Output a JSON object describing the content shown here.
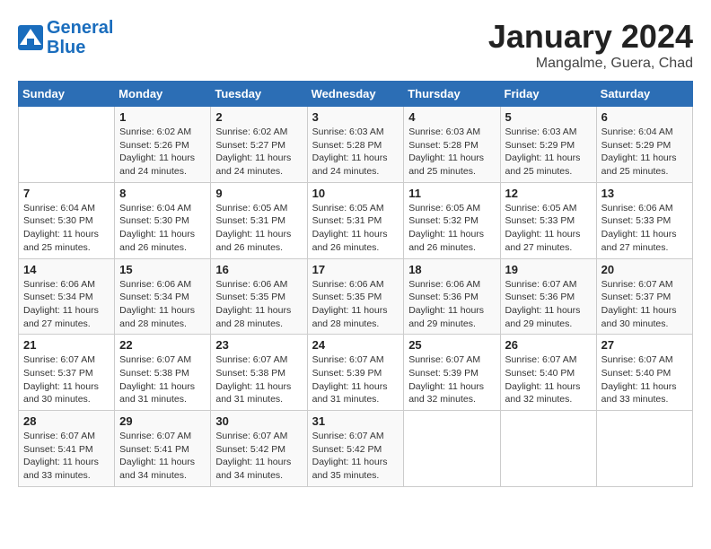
{
  "header": {
    "logo_line1": "General",
    "logo_line2": "Blue",
    "month_title": "January 2024",
    "location": "Mangalme, Guera, Chad"
  },
  "weekdays": [
    "Sunday",
    "Monday",
    "Tuesday",
    "Wednesday",
    "Thursday",
    "Friday",
    "Saturday"
  ],
  "weeks": [
    [
      {
        "day": "",
        "content": ""
      },
      {
        "day": "1",
        "content": "Sunrise: 6:02 AM\nSunset: 5:26 PM\nDaylight: 11 hours\nand 24 minutes."
      },
      {
        "day": "2",
        "content": "Sunrise: 6:02 AM\nSunset: 5:27 PM\nDaylight: 11 hours\nand 24 minutes."
      },
      {
        "day": "3",
        "content": "Sunrise: 6:03 AM\nSunset: 5:28 PM\nDaylight: 11 hours\nand 24 minutes."
      },
      {
        "day": "4",
        "content": "Sunrise: 6:03 AM\nSunset: 5:28 PM\nDaylight: 11 hours\nand 25 minutes."
      },
      {
        "day": "5",
        "content": "Sunrise: 6:03 AM\nSunset: 5:29 PM\nDaylight: 11 hours\nand 25 minutes."
      },
      {
        "day": "6",
        "content": "Sunrise: 6:04 AM\nSunset: 5:29 PM\nDaylight: 11 hours\nand 25 minutes."
      }
    ],
    [
      {
        "day": "7",
        "content": "Sunrise: 6:04 AM\nSunset: 5:30 PM\nDaylight: 11 hours\nand 25 minutes."
      },
      {
        "day": "8",
        "content": "Sunrise: 6:04 AM\nSunset: 5:30 PM\nDaylight: 11 hours\nand 26 minutes."
      },
      {
        "day": "9",
        "content": "Sunrise: 6:05 AM\nSunset: 5:31 PM\nDaylight: 11 hours\nand 26 minutes."
      },
      {
        "day": "10",
        "content": "Sunrise: 6:05 AM\nSunset: 5:31 PM\nDaylight: 11 hours\nand 26 minutes."
      },
      {
        "day": "11",
        "content": "Sunrise: 6:05 AM\nSunset: 5:32 PM\nDaylight: 11 hours\nand 26 minutes."
      },
      {
        "day": "12",
        "content": "Sunrise: 6:05 AM\nSunset: 5:33 PM\nDaylight: 11 hours\nand 27 minutes."
      },
      {
        "day": "13",
        "content": "Sunrise: 6:06 AM\nSunset: 5:33 PM\nDaylight: 11 hours\nand 27 minutes."
      }
    ],
    [
      {
        "day": "14",
        "content": "Sunrise: 6:06 AM\nSunset: 5:34 PM\nDaylight: 11 hours\nand 27 minutes."
      },
      {
        "day": "15",
        "content": "Sunrise: 6:06 AM\nSunset: 5:34 PM\nDaylight: 11 hours\nand 28 minutes."
      },
      {
        "day": "16",
        "content": "Sunrise: 6:06 AM\nSunset: 5:35 PM\nDaylight: 11 hours\nand 28 minutes."
      },
      {
        "day": "17",
        "content": "Sunrise: 6:06 AM\nSunset: 5:35 PM\nDaylight: 11 hours\nand 28 minutes."
      },
      {
        "day": "18",
        "content": "Sunrise: 6:06 AM\nSunset: 5:36 PM\nDaylight: 11 hours\nand 29 minutes."
      },
      {
        "day": "19",
        "content": "Sunrise: 6:07 AM\nSunset: 5:36 PM\nDaylight: 11 hours\nand 29 minutes."
      },
      {
        "day": "20",
        "content": "Sunrise: 6:07 AM\nSunset: 5:37 PM\nDaylight: 11 hours\nand 30 minutes."
      }
    ],
    [
      {
        "day": "21",
        "content": "Sunrise: 6:07 AM\nSunset: 5:37 PM\nDaylight: 11 hours\nand 30 minutes."
      },
      {
        "day": "22",
        "content": "Sunrise: 6:07 AM\nSunset: 5:38 PM\nDaylight: 11 hours\nand 31 minutes."
      },
      {
        "day": "23",
        "content": "Sunrise: 6:07 AM\nSunset: 5:38 PM\nDaylight: 11 hours\nand 31 minutes."
      },
      {
        "day": "24",
        "content": "Sunrise: 6:07 AM\nSunset: 5:39 PM\nDaylight: 11 hours\nand 31 minutes."
      },
      {
        "day": "25",
        "content": "Sunrise: 6:07 AM\nSunset: 5:39 PM\nDaylight: 11 hours\nand 32 minutes."
      },
      {
        "day": "26",
        "content": "Sunrise: 6:07 AM\nSunset: 5:40 PM\nDaylight: 11 hours\nand 32 minutes."
      },
      {
        "day": "27",
        "content": "Sunrise: 6:07 AM\nSunset: 5:40 PM\nDaylight: 11 hours\nand 33 minutes."
      }
    ],
    [
      {
        "day": "28",
        "content": "Sunrise: 6:07 AM\nSunset: 5:41 PM\nDaylight: 11 hours\nand 33 minutes."
      },
      {
        "day": "29",
        "content": "Sunrise: 6:07 AM\nSunset: 5:41 PM\nDaylight: 11 hours\nand 34 minutes."
      },
      {
        "day": "30",
        "content": "Sunrise: 6:07 AM\nSunset: 5:42 PM\nDaylight: 11 hours\nand 34 minutes."
      },
      {
        "day": "31",
        "content": "Sunrise: 6:07 AM\nSunset: 5:42 PM\nDaylight: 11 hours\nand 35 minutes."
      },
      {
        "day": "",
        "content": ""
      },
      {
        "day": "",
        "content": ""
      },
      {
        "day": "",
        "content": ""
      }
    ]
  ]
}
